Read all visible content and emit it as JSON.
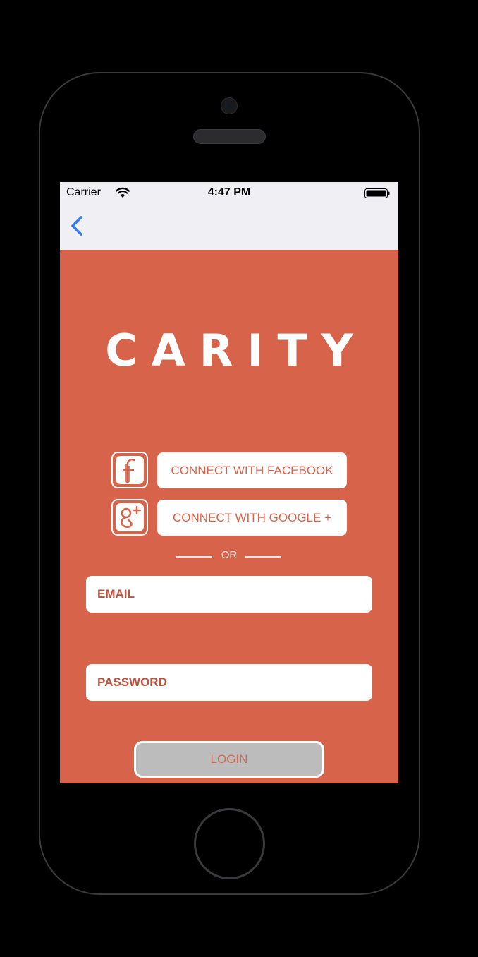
{
  "status_bar": {
    "carrier": "Carrier",
    "time": "4:47 PM"
  },
  "nav": {
    "back_icon": "chevron-left-icon"
  },
  "logo": {
    "text": "CARITY"
  },
  "social": {
    "facebook_label": "CONNECT WITH FACEBOOK",
    "google_label": "CONNECT WITH GOOGLE +",
    "facebook_icon": "facebook-icon",
    "google_icon": "google-plus-icon"
  },
  "divider": {
    "text": "OR"
  },
  "form": {
    "email_placeholder": "EMAIL",
    "email_value": "",
    "password_placeholder": "PASSWORD",
    "password_value": "",
    "login_label": "LOGIN"
  },
  "colors": {
    "brand": "#d8634b",
    "nav_background": "#efeff4",
    "ios_blue": "#2f7cf6",
    "login_disabled": "#bcbcbc"
  }
}
